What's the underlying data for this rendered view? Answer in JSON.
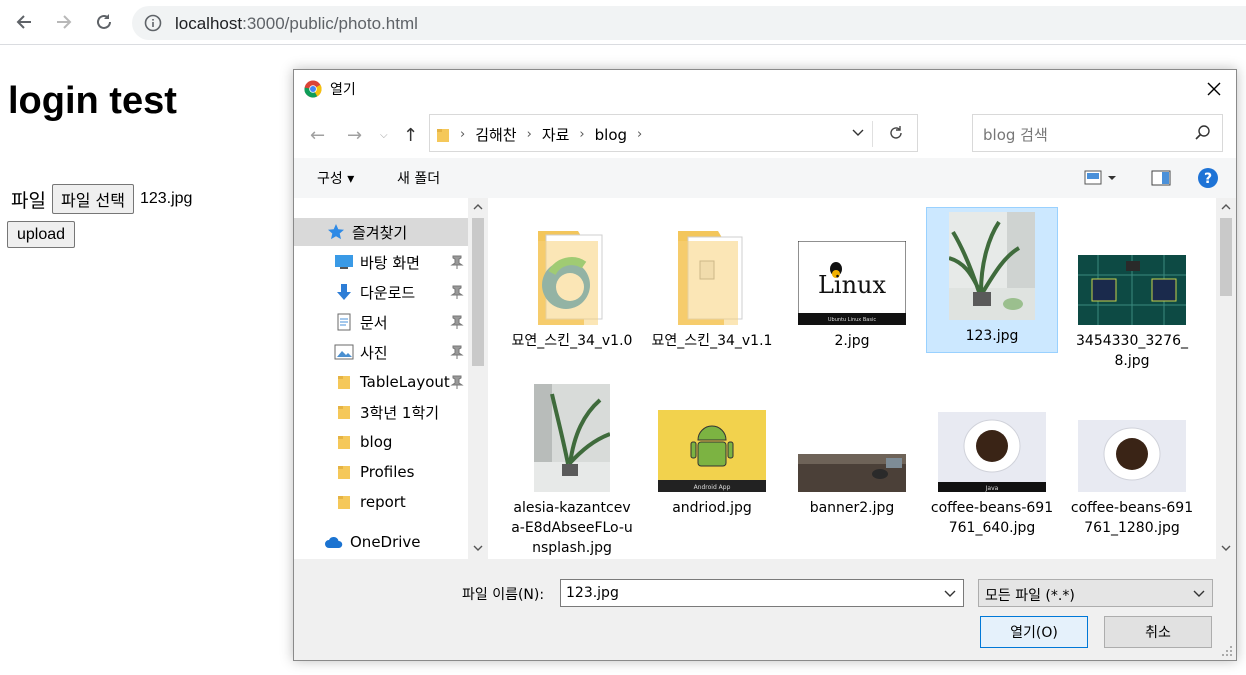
{
  "browser": {
    "url_host": "localhost",
    "url_rest": ":3000/public/photo.html"
  },
  "page": {
    "title": "login test",
    "file_label": "파일",
    "file_button": "파일 선택",
    "file_chosen": "123.jpg",
    "upload_button": "upload"
  },
  "dialog": {
    "title": "열기",
    "breadcrumbs": [
      "김해찬",
      "자료",
      "blog"
    ],
    "search_placeholder": "blog 검색",
    "toolbar": {
      "organize": "구성",
      "new_folder": "새 폴더"
    },
    "nav": [
      {
        "label": "즐겨찾기",
        "icon": "star-icon",
        "pinned": false
      },
      {
        "label": "바탕 화면",
        "icon": "desktop-icon",
        "pinned": true
      },
      {
        "label": "다운로드",
        "icon": "download-icon",
        "pinned": true
      },
      {
        "label": "문서",
        "icon": "document-icon",
        "pinned": true
      },
      {
        "label": "사진",
        "icon": "pictures-icon",
        "pinned": true
      },
      {
        "label": "TableLayout",
        "icon": "folder-icon",
        "pinned": true
      },
      {
        "label": "3학년 1학기",
        "icon": "folder-icon",
        "pinned": false
      },
      {
        "label": "blog",
        "icon": "folder-icon",
        "pinned": false
      },
      {
        "label": "Profiles",
        "icon": "folder-icon",
        "pinned": false
      },
      {
        "label": "report",
        "icon": "folder-icon",
        "pinned": false
      },
      {
        "label": "OneDrive",
        "icon": "cloud-icon",
        "pinned": false
      }
    ],
    "files": [
      {
        "name": "묘연_스킨_34_v1.0",
        "kind": "folder-edge"
      },
      {
        "name": "묘연_스킨_34_v1.1",
        "kind": "folder-doc"
      },
      {
        "name": "2.jpg",
        "kind": "linux",
        "overlay_title": "Linux",
        "overlay_sub": "Ubuntu Linux Basic"
      },
      {
        "name": "123.jpg",
        "kind": "plant",
        "selected": true
      },
      {
        "name": "3454330_3276_8.jpg",
        "kind": "circuit"
      },
      {
        "name": "alesia-kazantceva-E8dAbseeFLo-unsplash.jpg",
        "kind": "plant-tall"
      },
      {
        "name": "andriod.jpg",
        "kind": "android",
        "overlay_sub": "Android App"
      },
      {
        "name": "banner2.jpg",
        "kind": "desk"
      },
      {
        "name": "coffee-beans-691761_640.jpg",
        "kind": "coffee",
        "overlay_sub": "Java"
      },
      {
        "name": "coffee-beans-691761_1280.jpg",
        "kind": "coffee2"
      }
    ],
    "filename_label": "파일 이름(N):",
    "filename_value": "123.jpg",
    "filter_value": "모든 파일 (*.*)",
    "open_button": "열기(O)",
    "cancel_button": "취소"
  }
}
